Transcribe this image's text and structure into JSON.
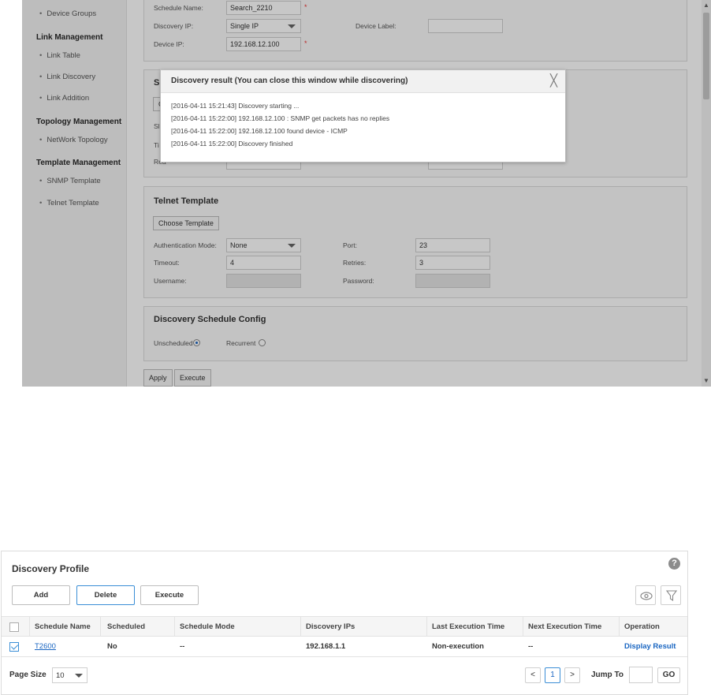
{
  "sidebar": {
    "device_groups": "Device Groups",
    "link_management": "Link Management",
    "link_table": "Link Table",
    "link_discovery": "Link Discovery",
    "link_addition": "Link Addition",
    "topology_management": "Topology Management",
    "network_topology": "NetWork Topology",
    "template_management": "Template Management",
    "snmp_template": "SNMP Template",
    "telnet_template": "Telnet Template"
  },
  "schedule_form": {
    "schedule_name_label": "Schedule Name:",
    "schedule_name_value": "Search_2210",
    "discovery_ip_label": "Discovery IP:",
    "discovery_ip_value": "Single IP",
    "device_label_label": "Device Label:",
    "device_ip_label": "Device IP:",
    "device_ip_value": "192.168.12.100",
    "required_mark": "*"
  },
  "snmp_partial": {
    "title_fragment": "Sl",
    "button_fragment": "C",
    "lbl1_fragment": "Sl",
    "lbl2_fragment": "Ti",
    "lbl3_fragment": "Rea"
  },
  "telnet_template": {
    "title": "Telnet Template",
    "choose_button": "Choose Template",
    "auth_mode_label": "Authentication Mode:",
    "auth_mode_value": "None",
    "port_label": "Port:",
    "port_value": "23",
    "timeout_label": "Timeout:",
    "timeout_value": "4",
    "retries_label": "Retries:",
    "retries_value": "3",
    "username_label": "Username:",
    "password_label": "Password:"
  },
  "schedule_config": {
    "title": "Discovery Schedule Config",
    "unscheduled_label": "Unscheduled",
    "recurrent_label": "Recurrent",
    "selected": "Unscheduled"
  },
  "actions": {
    "apply": "Apply",
    "execute": "Execute"
  },
  "modal": {
    "title": "Discovery result (You can close this window while discovering)",
    "close_glyph": "╳",
    "logs": [
      "[2016-04-11 15:21:43] Discovery starting ...",
      "[2016-04-11 15:22:00] 192.168.12.100 : SNMP get packets has no replies",
      "[2016-04-11 15:22:00] 192.168.12.100 found device - ICMP",
      "[2016-04-11 15:22:00] Discovery finished"
    ]
  },
  "discovery_profile": {
    "title": "Discovery Profile",
    "help_glyph": "?",
    "buttons": {
      "add": "Add",
      "delete": "Delete",
      "execute": "Execute"
    },
    "columns": [
      "Schedule Name",
      "Scheduled",
      "Schedule Mode",
      "Discovery IPs",
      "Last Execution Time",
      "Next Execution Time",
      "Operation"
    ],
    "rows": [
      {
        "schedule_name": "T2600",
        "scheduled": "No",
        "schedule_mode": "--",
        "discovery_ips": "192.168.1.1",
        "last_execution_time": "Non-execution",
        "next_execution_time": "--",
        "operation": "Display Result",
        "checked": true
      }
    ],
    "pager": {
      "page_size_label": "Page Size",
      "page_size_value": "10",
      "prev": "<",
      "current_page": "1",
      "next": ">",
      "jump_to_label": "Jump To",
      "go": "GO"
    }
  },
  "colors": {
    "accent": "#1a66c2",
    "active_border": "#3a8ed6",
    "required": "#e33333",
    "sidebar_bg": "#f3f3f3"
  }
}
